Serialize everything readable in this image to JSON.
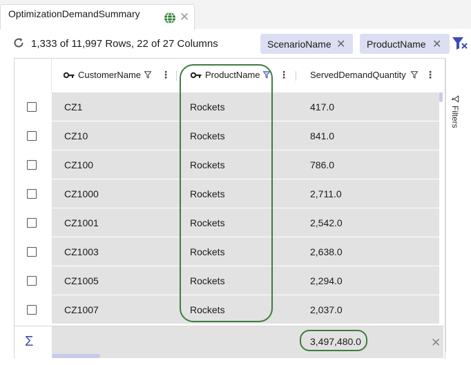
{
  "tab": {
    "title": "OptimizationDemandSummary"
  },
  "toolbar": {
    "summary": "1,333 of 11,997 Rows, 22 of 27 Columns",
    "chips": [
      {
        "label": "ScenarioName"
      },
      {
        "label": "ProductName"
      }
    ],
    "close_glyph": "✕"
  },
  "grid": {
    "columns": [
      {
        "label": "CustomerName",
        "key": true,
        "filtered": false
      },
      {
        "label": "ProductName",
        "key": true,
        "filtered": true
      },
      {
        "label": "ServedDemandQuantity",
        "key": false,
        "filtered": false
      }
    ],
    "rows": [
      {
        "customer": "CZ1",
        "product": "Rockets",
        "qty": "417.0"
      },
      {
        "customer": "CZ10",
        "product": "Rockets",
        "qty": "841.0"
      },
      {
        "customer": "CZ100",
        "product": "Rockets",
        "qty": "786.0"
      },
      {
        "customer": "CZ1000",
        "product": "Rockets",
        "qty": "2,711.0"
      },
      {
        "customer": "CZ1001",
        "product": "Rockets",
        "qty": "2,542.0"
      },
      {
        "customer": "CZ1003",
        "product": "Rockets",
        "qty": "2,638.0"
      },
      {
        "customer": "CZ1005",
        "product": "Rockets",
        "qty": "2,294.0"
      },
      {
        "customer": "CZ1007",
        "product": "Rockets",
        "qty": "2,037.0"
      }
    ],
    "footer": {
      "sigma": "Σ",
      "total": "3,497,480.0"
    }
  },
  "side_panel": {
    "label": "Filters"
  },
  "colors": {
    "accent": "#3d4bb5",
    "chip_bg": "#dcdff1",
    "annotation": "#3e7b3e",
    "row_bg": "#e2e2e2"
  }
}
